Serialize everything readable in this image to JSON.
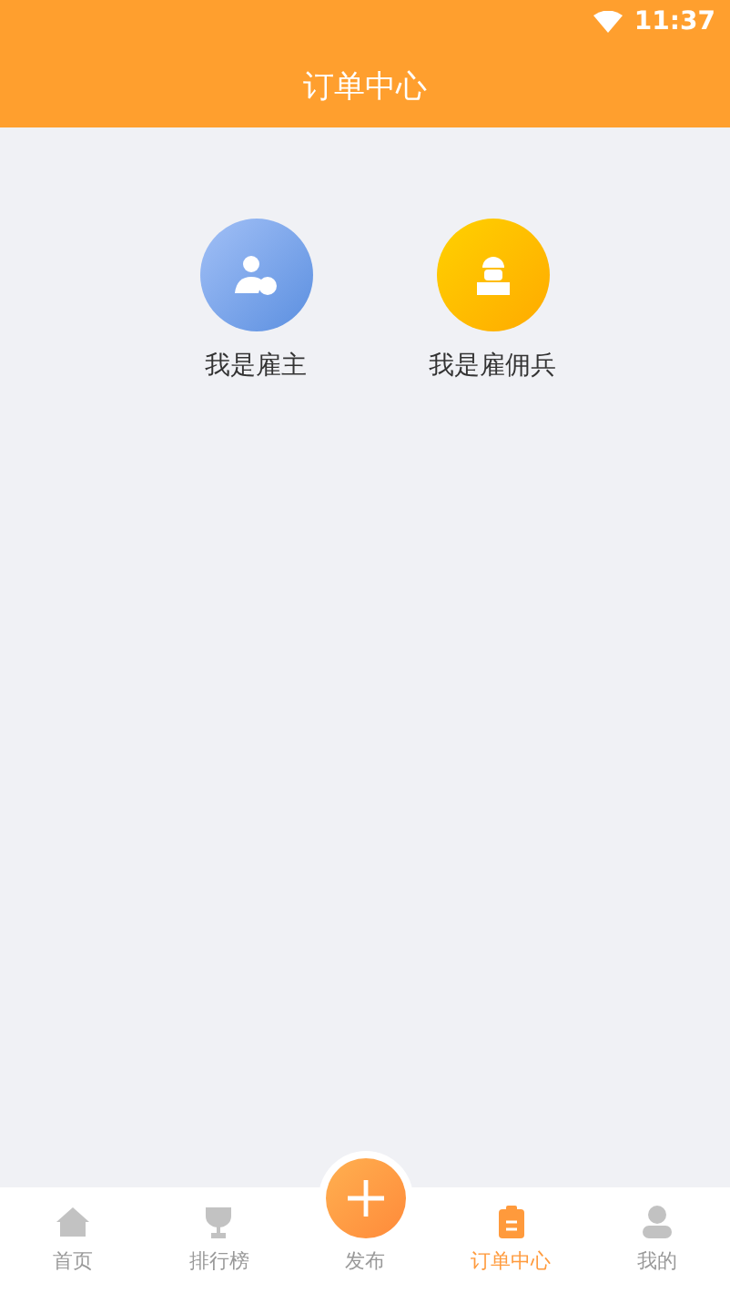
{
  "status_bar": {
    "time": "11:37"
  },
  "header": {
    "title": "订单中心"
  },
  "roles": [
    {
      "label": "我是雇主",
      "kind": "employer"
    },
    {
      "label": "我是雇佣兵",
      "kind": "worker"
    }
  ],
  "tab_bar": [
    {
      "label": "首页",
      "kind": "tab",
      "selected": false
    },
    {
      "label": "排行榜",
      "kind": "tab",
      "selected": false
    },
    {
      "label": "发布",
      "kind": "publish",
      "selected": false
    },
    {
      "label": "订单中心",
      "kind": "tab",
      "selected": true
    },
    {
      "label": "我的",
      "kind": "tab",
      "selected": false
    }
  ]
}
